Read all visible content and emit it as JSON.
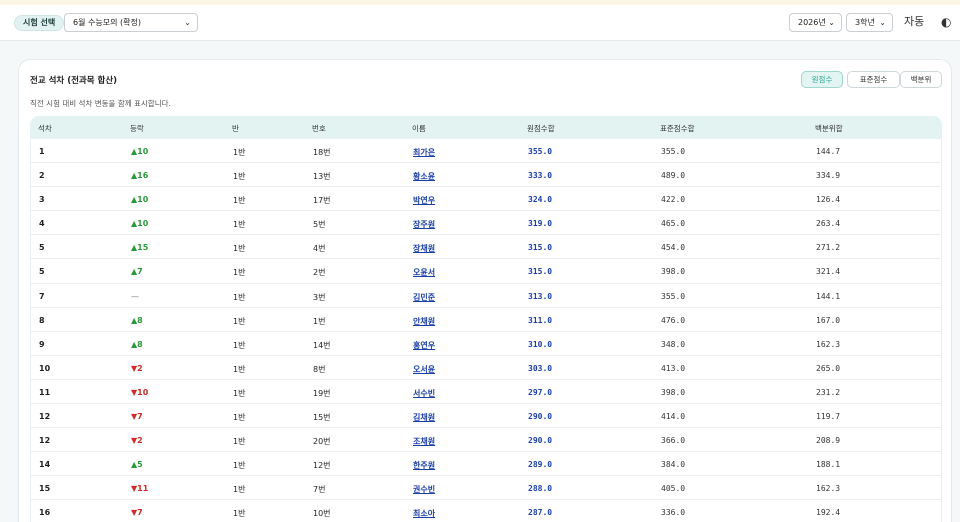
{
  "header": {
    "exam_label": "시험 선택",
    "exam_select": "6월 수능모의 (확정)",
    "year_select": "2026년",
    "grade_select": "3학년",
    "theme_label": "자동",
    "theme_icon": "contrast-icon"
  },
  "card": {
    "title": "전교 석차 (전과목 합산)",
    "subtitle": "직전 시험 대비 석차 변동을 함께 표시합니다.",
    "tabs": [
      "원점수",
      "표준점수",
      "백분위"
    ],
    "active_tab": "원점수"
  },
  "table": {
    "headers": [
      "석차",
      "등락",
      "반",
      "번호",
      "이름",
      "원점수합",
      "표준점수합",
      "백분위합"
    ],
    "rows": [
      {
        "rank": "1",
        "dir": "up",
        "chg": "10",
        "cls": "1반",
        "num": "18번",
        "name": "최가은",
        "raw": "355.0",
        "std": "355.0",
        "pct": "144.7"
      },
      {
        "rank": "2",
        "dir": "up",
        "chg": "16",
        "cls": "1반",
        "num": "13번",
        "name": "황소윤",
        "raw": "333.0",
        "std": "489.0",
        "pct": "334.9"
      },
      {
        "rank": "3",
        "dir": "up",
        "chg": "10",
        "cls": "1반",
        "num": "17번",
        "name": "박연우",
        "raw": "324.0",
        "std": "422.0",
        "pct": "126.4"
      },
      {
        "rank": "4",
        "dir": "up",
        "chg": "10",
        "cls": "1반",
        "num": "5번",
        "name": "장주원",
        "raw": "319.0",
        "std": "465.0",
        "pct": "263.4"
      },
      {
        "rank": "5",
        "dir": "up",
        "chg": "15",
        "cls": "1반",
        "num": "4번",
        "name": "장채원",
        "raw": "315.0",
        "std": "454.0",
        "pct": "271.2"
      },
      {
        "rank": "5",
        "dir": "up",
        "chg": "7",
        "cls": "1반",
        "num": "2번",
        "name": "오윤서",
        "raw": "315.0",
        "std": "398.0",
        "pct": "321.4"
      },
      {
        "rank": "7",
        "dir": "flat",
        "chg": "—",
        "cls": "1반",
        "num": "3번",
        "name": "김민준",
        "raw": "313.0",
        "std": "355.0",
        "pct": "144.1"
      },
      {
        "rank": "8",
        "dir": "up",
        "chg": "8",
        "cls": "1반",
        "num": "1번",
        "name": "안채원",
        "raw": "311.0",
        "std": "476.0",
        "pct": "167.0"
      },
      {
        "rank": "9",
        "dir": "up",
        "chg": "8",
        "cls": "1반",
        "num": "14번",
        "name": "홍연우",
        "raw": "310.0",
        "std": "348.0",
        "pct": "162.3"
      },
      {
        "rank": "10",
        "dir": "down",
        "chg": "2",
        "cls": "1반",
        "num": "8번",
        "name": "오서윤",
        "raw": "303.0",
        "std": "413.0",
        "pct": "265.0"
      },
      {
        "rank": "11",
        "dir": "down",
        "chg": "10",
        "cls": "1반",
        "num": "19번",
        "name": "서수빈",
        "raw": "297.0",
        "std": "398.0",
        "pct": "231.2"
      },
      {
        "rank": "12",
        "dir": "down",
        "chg": "7",
        "cls": "1반",
        "num": "15번",
        "name": "김채원",
        "raw": "290.0",
        "std": "414.0",
        "pct": "119.7"
      },
      {
        "rank": "12",
        "dir": "down",
        "chg": "2",
        "cls": "1반",
        "num": "20번",
        "name": "조채원",
        "raw": "290.0",
        "std": "366.0",
        "pct": "208.9"
      },
      {
        "rank": "14",
        "dir": "up",
        "chg": "5",
        "cls": "1반",
        "num": "12번",
        "name": "한주원",
        "raw": "289.0",
        "std": "384.0",
        "pct": "188.1"
      },
      {
        "rank": "15",
        "dir": "down",
        "chg": "11",
        "cls": "1반",
        "num": "7번",
        "name": "권수빈",
        "raw": "288.0",
        "std": "405.0",
        "pct": "162.3"
      },
      {
        "rank": "16",
        "dir": "down",
        "chg": "7",
        "cls": "1반",
        "num": "10번",
        "name": "최소아",
        "raw": "287.0",
        "std": "336.0",
        "pct": "192.4"
      }
    ]
  },
  "colors": {
    "up": "#2a9a3a",
    "down": "#d12a2a",
    "accent": "#27a690",
    "link": "#1b3fa8"
  }
}
